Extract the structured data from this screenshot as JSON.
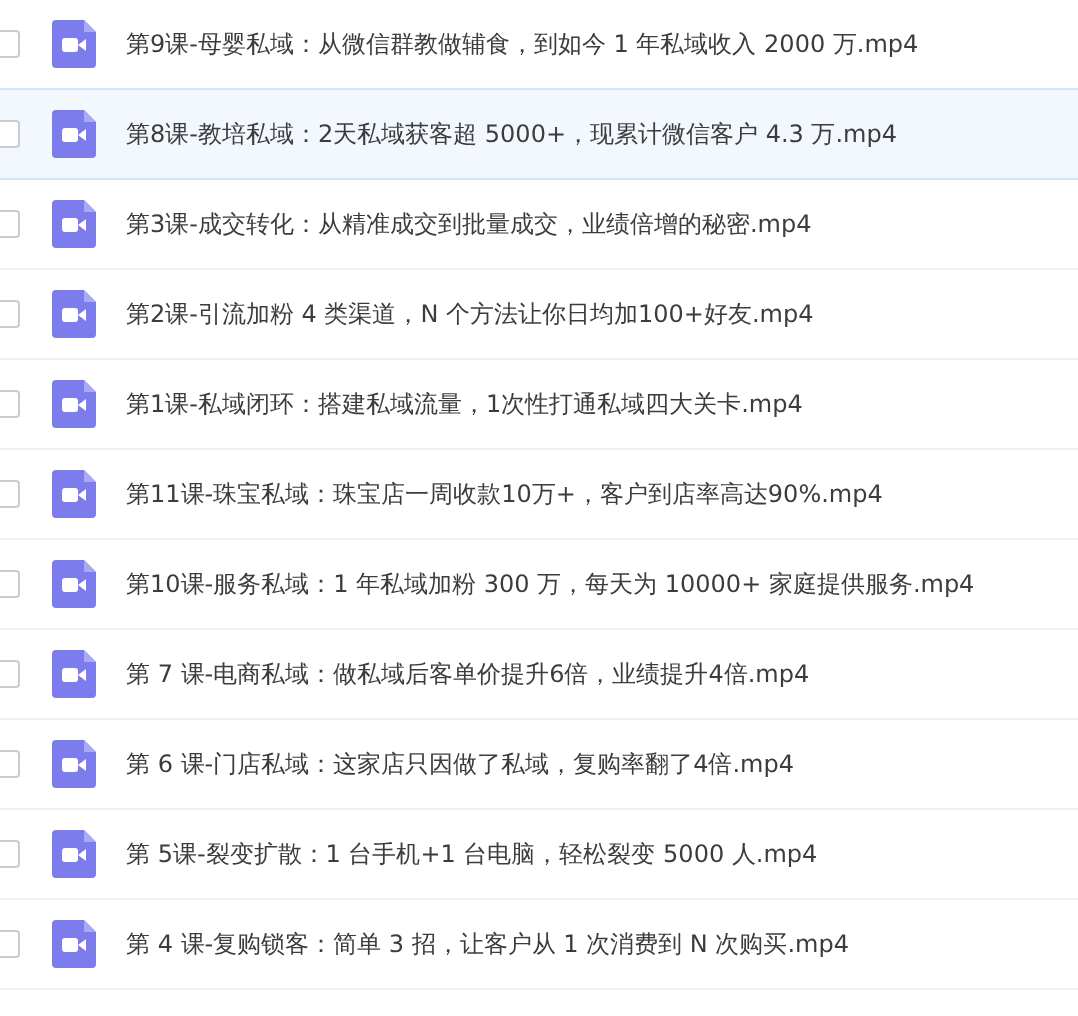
{
  "files": [
    {
      "name": "第9课-母婴私域：从微信群教做辅食，到如今 1 年私域收入 2000 万.mp4",
      "selected": false,
      "checked": false
    },
    {
      "name": "第8课-教培私域：2天私域获客超 5000+，现累计微信客户 4.3 万.mp4",
      "selected": true,
      "checked": false
    },
    {
      "name": "第3课-成交转化：从精准成交到批量成交，业绩倍增的秘密.mp4",
      "selected": false,
      "checked": false
    },
    {
      "name": "第2课-引流加粉 4 类渠道，N 个方法让你日均加100+好友.mp4",
      "selected": false,
      "checked": false
    },
    {
      "name": "第1课-私域闭环：搭建私域流量，1次性打通私域四大关卡.mp4",
      "selected": false,
      "checked": false
    },
    {
      "name": "第11课-珠宝私域：珠宝店一周收款10万+，客户到店率高达90%.mp4",
      "selected": false,
      "checked": false
    },
    {
      "name": "第10课-服务私域：1 年私域加粉 300 万，每天为 10000+ 家庭提供服务.mp4",
      "selected": false,
      "checked": false
    },
    {
      "name": "第 7 课-电商私域：做私域后客单价提升6倍，业绩提升4倍.mp4",
      "selected": false,
      "checked": false
    },
    {
      "name": "第 6 课-门店私域：这家店只因做了私域，复购率翻了4倍.mp4",
      "selected": false,
      "checked": false
    },
    {
      "name": "第 5课-裂变扩散：1 台手机+1 台电脑，轻松裂变 5000 人.mp4",
      "selected": false,
      "checked": false
    },
    {
      "name": "第 4 课-复购锁客：简单 3 招，让客户从 1 次消费到 N 次购买.mp4",
      "selected": false,
      "checked": false
    }
  ]
}
